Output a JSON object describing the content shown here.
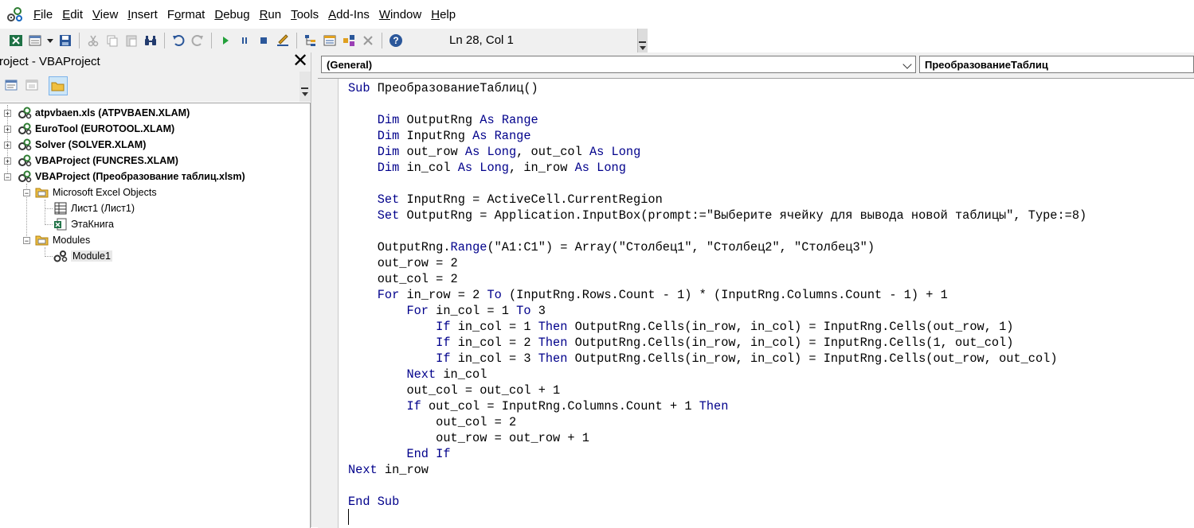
{
  "menu": {
    "items": [
      {
        "pre": "",
        "u": "F",
        "post": "ile"
      },
      {
        "pre": "",
        "u": "E",
        "post": "dit"
      },
      {
        "pre": "",
        "u": "V",
        "post": "iew"
      },
      {
        "pre": "",
        "u": "I",
        "post": "nsert"
      },
      {
        "pre": "F",
        "u": "o",
        "post": "rmat"
      },
      {
        "pre": "",
        "u": "D",
        "post": "ebug"
      },
      {
        "pre": "",
        "u": "R",
        "post": "un"
      },
      {
        "pre": "",
        "u": "T",
        "post": "ools"
      },
      {
        "pre": "",
        "u": "A",
        "post": "dd-Ins"
      },
      {
        "pre": "",
        "u": "W",
        "post": "indow"
      },
      {
        "pre": "",
        "u": "H",
        "post": "elp"
      }
    ]
  },
  "toolbar": {
    "status": "Ln 28, Col 1",
    "buttons": [
      "view-excel-icon",
      "insert-module-icon",
      "save-icon",
      "cut-icon",
      "copy-icon",
      "paste-icon",
      "find-icon",
      "undo-icon",
      "redo-icon",
      "run-icon",
      "break-icon",
      "reset-icon",
      "design-mode-icon",
      "project-explorer-icon",
      "properties-icon",
      "object-browser-icon",
      "toolbox-icon",
      "help-icon"
    ]
  },
  "project": {
    "title": "Project - VBAProject",
    "close": "✕",
    "tree": [
      {
        "label": "atpvbaen.xls (ATPVBAEN.XLAM)",
        "bold": true
      },
      {
        "label": "EuroTool (EUROTOOL.XLAM)",
        "bold": true
      },
      {
        "label": "Solver (SOLVER.XLAM)",
        "bold": true
      },
      {
        "label": "VBAProject (FUNCRES.XLAM)",
        "bold": true
      },
      {
        "label": "VBAProject (Преобразование таблиц.xlsm)",
        "bold": true
      },
      {
        "label": "Microsoft Excel Objects",
        "bold": false
      },
      {
        "label": "Лист1 (Лист1)",
        "bold": false
      },
      {
        "label": "ЭтаКнига",
        "bold": false
      },
      {
        "label": "Modules",
        "bold": false
      },
      {
        "label": "Module1",
        "bold": false
      }
    ]
  },
  "code": {
    "object_combo": "(General)",
    "proc_combo": "ПреобразованиеТаблиц",
    "lines": [
      "Sub ПреобразованиеТаблиц()",
      "",
      "    Dim OutputRng As Range",
      "    Dim InputRng As Range",
      "    Dim out_row As Long, out_col As Long",
      "    Dim in_col As Long, in_row As Long",
      "",
      "    Set InputRng = ActiveCell.CurrentRegion",
      "    Set OutputRng = Application.InputBox(prompt:=\"Выберите ячейку для вывода новой таблицы\", Type:=8)",
      "",
      "    OutputRng.Range(\"A1:C1\") = Array(\"Столбец1\", \"Столбец2\", \"Столбец3\")",
      "    out_row = 2",
      "    out_col = 2",
      "    For in_row = 2 To (InputRng.Rows.Count - 1) * (InputRng.Columns.Count - 1) + 1",
      "        For in_col = 1 To 3",
      "            If in_col = 1 Then OutputRng.Cells(in_row, in_col) = InputRng.Cells(out_row, 1)",
      "            If in_col = 2 Then OutputRng.Cells(in_row, in_col) = InputRng.Cells(1, out_col)",
      "            If in_col = 3 Then OutputRng.Cells(in_row, in_col) = InputRng.Cells(out_row, out_col)",
      "        Next in_col",
      "        out_col = out_col + 1",
      "        If out_col = InputRng.Columns.Count + 1 Then",
      "            out_col = 2",
      "            out_row = out_row + 1",
      "        End If",
      "Next in_row",
      "",
      "End Sub",
      ""
    ],
    "keywords": [
      "Sub",
      "Dim",
      "As",
      "Range",
      "Long",
      "Set",
      "For",
      "To",
      "Then",
      "If",
      "Next",
      "End"
    ]
  },
  "colors": {
    "keyword": "#00008b",
    "panel_bg": "#f0f0f0"
  }
}
